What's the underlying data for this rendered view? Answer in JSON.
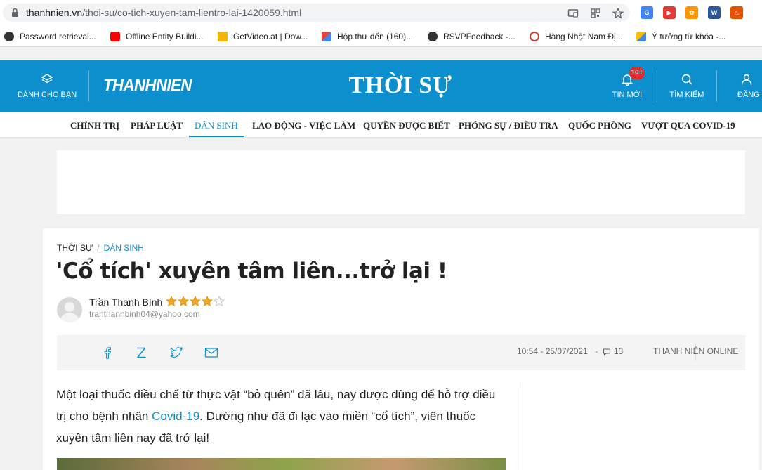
{
  "browser": {
    "url_host": "thanhnien.vn",
    "url_path": "/thoi-su/co-tich-xuyen-tam-lientro-lai-1420059.html",
    "bookmarks": [
      {
        "label": "Password retrieval...",
        "color": "#333333"
      },
      {
        "label": "Offline Entity Buildi...",
        "color": "#ff0000"
      },
      {
        "label": "GetVideo.at | Dow...",
        "color": "#f4b400"
      },
      {
        "label": "Hộp thư đến (160)...",
        "color": "#ea4335"
      },
      {
        "label": "RSVPFeedback -...",
        "color": "#333333"
      },
      {
        "label": "Hàng Nhật Nam Đị...",
        "color": "#c0392b"
      },
      {
        "label": "Ý tưởng từ khóa -...",
        "color": "#4285f4"
      }
    ],
    "extensions": [
      {
        "name": "translate-extension-icon",
        "color": "#4285f4",
        "glyph": "G"
      },
      {
        "name": "video-extension-icon",
        "color": "#e53935",
        "glyph": "▶"
      },
      {
        "name": "cashback-extension-icon",
        "color": "#ff9800",
        "glyph": "✿"
      },
      {
        "name": "word-extension-icon",
        "color": "#2b579a",
        "glyph": "W"
      },
      {
        "name": "fire-extension-icon",
        "color": "#e65100",
        "glyph": "♨"
      }
    ]
  },
  "header": {
    "for_you": "DÀNH CHO BẠN",
    "logo": "THANHNIEN",
    "section": "THỜI SỰ",
    "news_badge": "10+",
    "news_label": "TIN MỚI",
    "search_label": "TÌM KIẾM",
    "login_label": "ĐĂNG"
  },
  "categories": [
    {
      "label": "CHÍNH TRỊ",
      "active": false
    },
    {
      "label": "PHÁP LUẬT",
      "active": false
    },
    {
      "label": "DÂN SINH",
      "active": true
    },
    {
      "label": "LAO ĐỘNG - VIỆC LÀM",
      "active": false
    },
    {
      "label": "QUYỀN ĐƯỢC BIẾT",
      "active": false
    },
    {
      "label": "PHÓNG SỰ / ĐIỀU TRA",
      "active": false
    },
    {
      "label": "QUỐC PHÒNG",
      "active": false
    },
    {
      "label": "VƯỢT QUA COVID-19",
      "active": false
    }
  ],
  "article": {
    "breadcrumb_parent": "THỜI SỰ",
    "breadcrumb_separator": "/",
    "breadcrumb_current": "DÂN SINH",
    "title": "'Cổ tích' xuyên tâm liên...trở lại !",
    "author": "Trần Thanh Bình",
    "rating": 4,
    "rating_max": 5,
    "email": "tranthanhbinh04@yahoo.com",
    "datetime": "10:54 - 25/07/2021",
    "dash": "-",
    "comments": "13",
    "source": "THANH NIÊN ONLINE",
    "sapo_before_link": "Một loại thuốc điều chế từ thực vật “bỏ quên” đã lâu, nay được dùng để hỗ trợ điều trị cho bệnh nhân ",
    "sapo_link": "Covid-19",
    "sapo_after_link": ". Dường như đã đi lạc vào miền “cổ tích”, viên thuốc xuyên tâm liên nay đã trở lại!"
  },
  "colors": {
    "brand": "#0d8fcd",
    "star": "#f5a623"
  }
}
